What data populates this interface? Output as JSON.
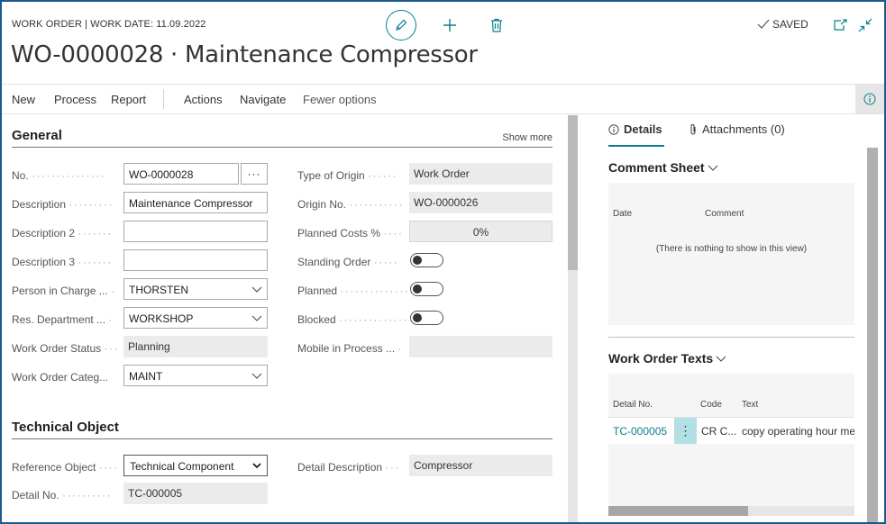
{
  "header": {
    "caption": "WORK ORDER | WORK DATE: 11.09.2022",
    "title": "WO-0000028 · Maintenance Compressor",
    "saved_label": "SAVED"
  },
  "actions": {
    "new": "New",
    "process": "Process",
    "report": "Report",
    "actions": "Actions",
    "navigate": "Navigate",
    "fewer": "Fewer options"
  },
  "general": {
    "title": "General",
    "show_more": "Show more",
    "no_label": "No.",
    "no_value": "WO-0000028",
    "description_label": "Description",
    "description_value": "Maintenance Compressor",
    "description2_label": "Description 2",
    "description2_value": "",
    "description3_label": "Description 3",
    "description3_value": "",
    "person_label": "Person in Charge ...",
    "person_value": "THORSTEN",
    "dept_label": "Res. Department ...",
    "dept_value": "WORKSHOP",
    "status_label": "Work Order Status",
    "status_value": "Planning",
    "category_label": "Work Order Categ...",
    "category_value": "MAINT",
    "origin_type_label": "Type of Origin",
    "origin_type_value": "Work Order",
    "origin_no_label": "Origin No.",
    "origin_no_value": "WO-0000026",
    "planned_costs_label": "Planned Costs %",
    "planned_costs_value": "0%",
    "standing_label": "Standing Order",
    "planned_label": "Planned",
    "blocked_label": "Blocked",
    "mobile_label": "Mobile in Process ...",
    "mobile_value": ""
  },
  "technical": {
    "title": "Technical Object",
    "ref_label": "Reference Object",
    "ref_value": "Technical Component",
    "detail_no_label": "Detail No.",
    "detail_no_value": "TC-000005",
    "detail_desc_label": "Detail Description",
    "detail_desc_value": "Compressor"
  },
  "pane": {
    "tab_details": "Details",
    "tab_attachments": "Attachments (0)",
    "comment_title": "Comment Sheet",
    "comment_col_date": "Date",
    "comment_col_comment": "Comment",
    "comment_empty": "(There is nothing to show in this view)",
    "texts_title": "Work Order Texts",
    "texts_col_detail": "Detail No.",
    "texts_col_code": "Code",
    "texts_col_text": "Text",
    "texts_rows": [
      {
        "detail_no": "TC-000005",
        "code": "CR C...",
        "text": "copy operating hour me"
      }
    ]
  },
  "colors": {
    "accent": "#0a7f8c",
    "frame": "#1b5a8c"
  }
}
